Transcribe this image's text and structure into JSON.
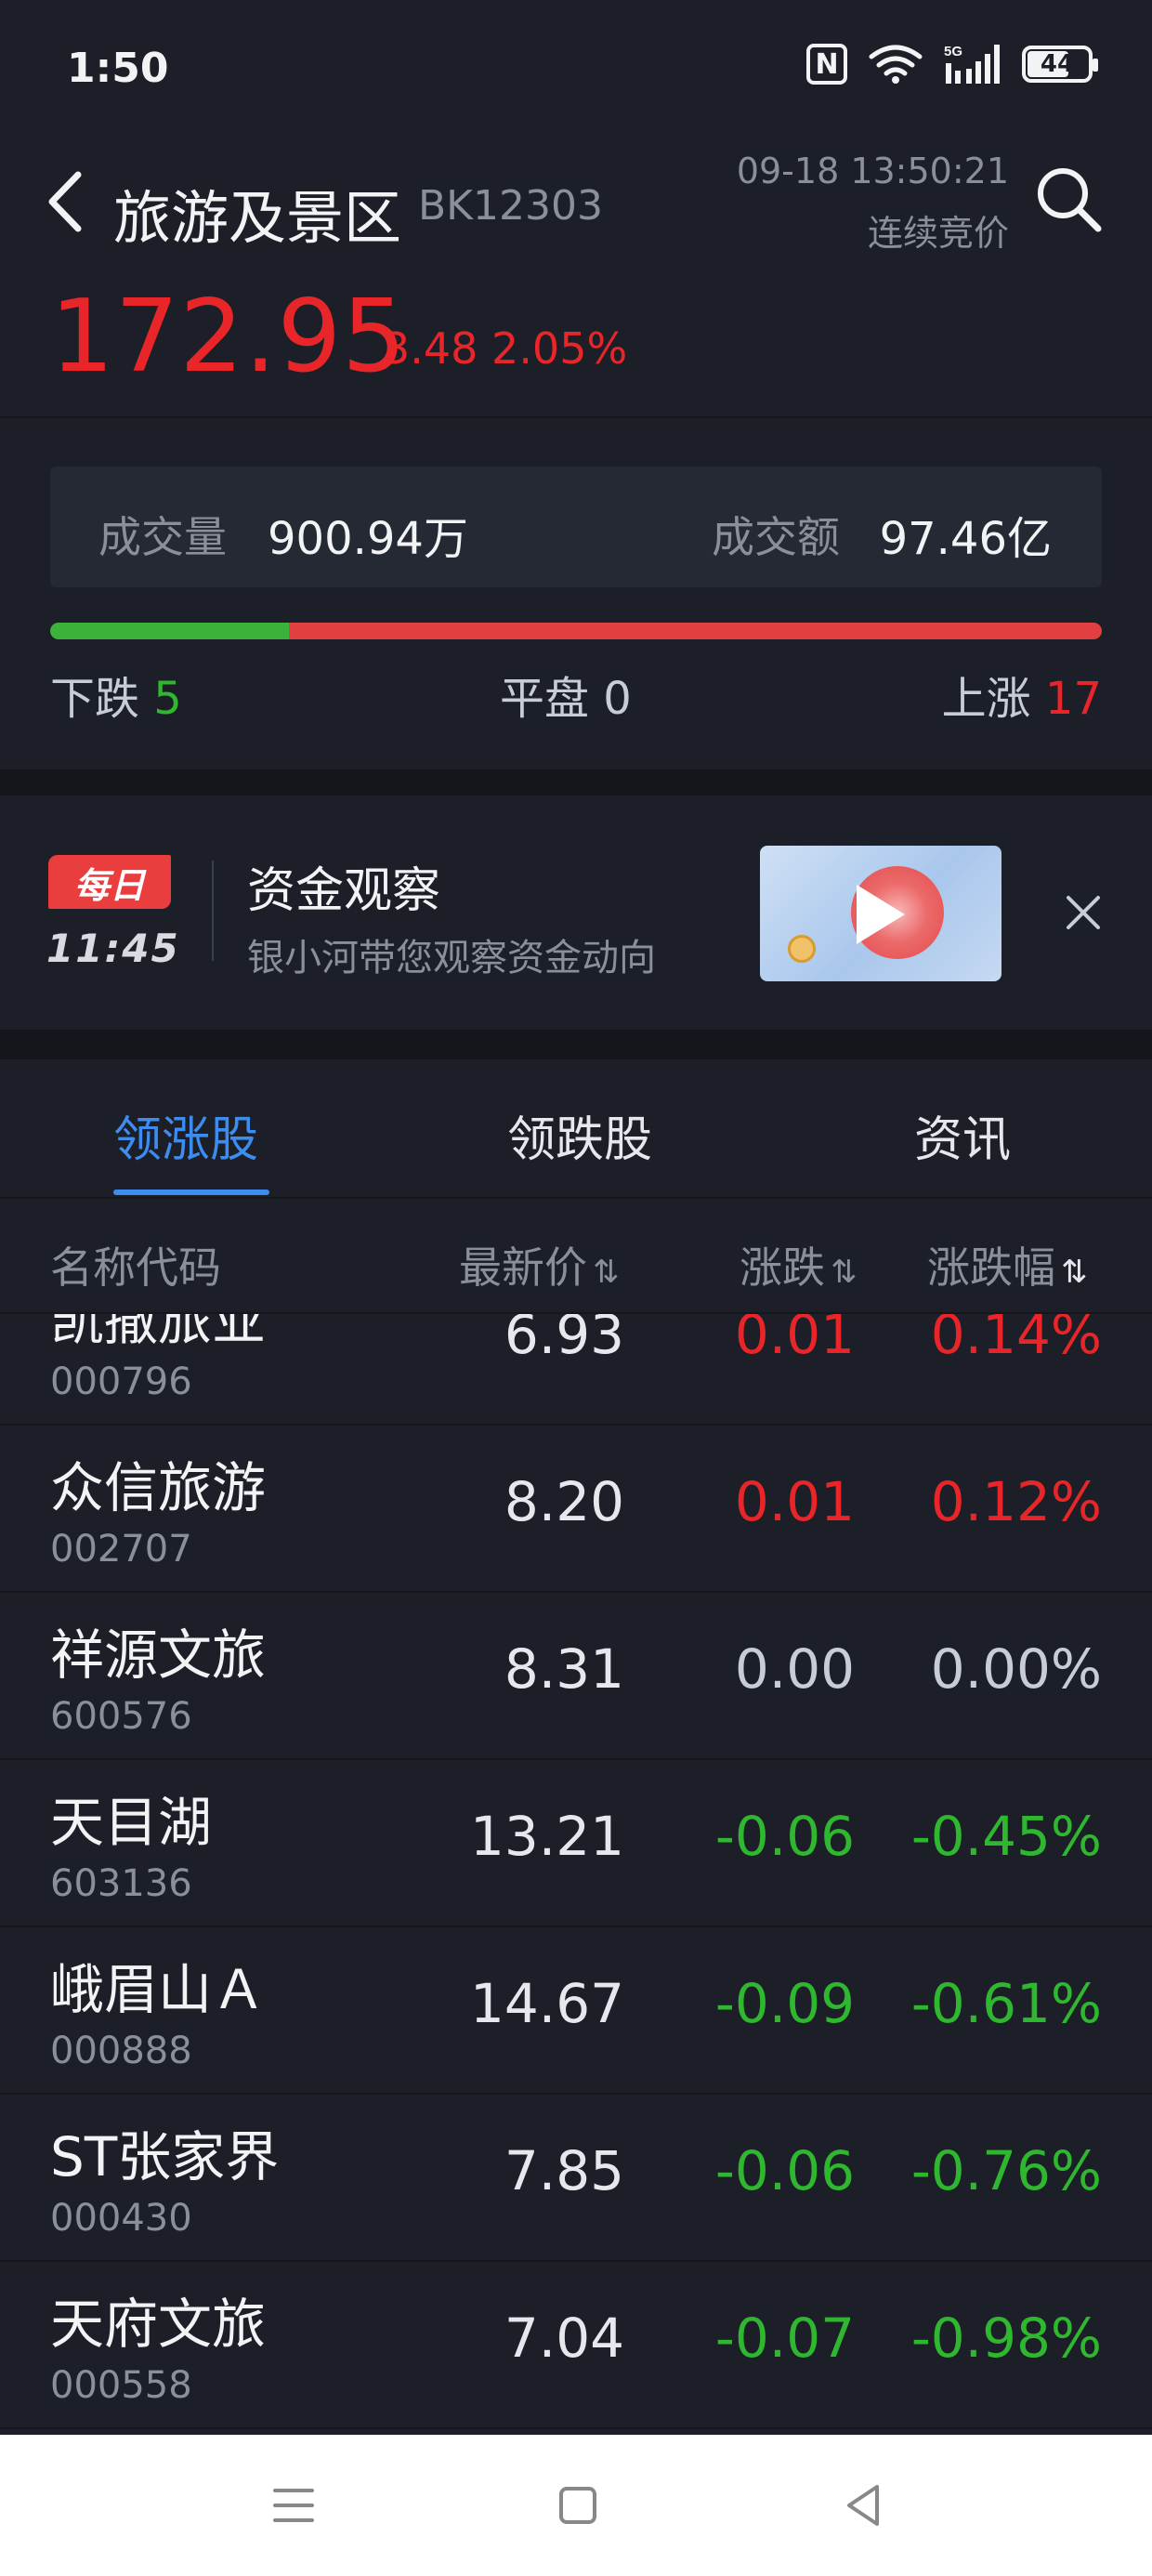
{
  "status_bar": {
    "time": "1:50",
    "network": "5G",
    "battery": "44"
  },
  "header": {
    "title": "旅游及景区",
    "code": "BK12303",
    "datetime": "09-18 13:50:21",
    "phase": "连续竞价",
    "price": "172.95",
    "change": "3.48",
    "change_pct": "2.05%"
  },
  "stats": {
    "volume_label": "成交量",
    "volume_value": "900.94万",
    "amount_label": "成交额",
    "amount_value": "97.46亿",
    "down_label": "下跌",
    "down_count": "5",
    "flat_label": "平盘",
    "flat_count": "0",
    "up_label": "上涨",
    "up_count": "17"
  },
  "breadth": {
    "down": 5,
    "flat": 0,
    "up": 17
  },
  "banner": {
    "badge": "每日",
    "time": "11:45",
    "title": "资金观察",
    "subtitle": "银小河带您观察资金动向"
  },
  "tabs": [
    {
      "label": "领涨股",
      "active": true
    },
    {
      "label": "领跌股",
      "active": false
    },
    {
      "label": "资讯",
      "active": false
    }
  ],
  "table": {
    "headers": {
      "name": "名称代码",
      "price": "最新价",
      "change": "涨跌",
      "change_pct": "涨跌幅"
    },
    "rows": [
      {
        "name": "凯撒旅业",
        "code": "000796",
        "price": "6.93",
        "change": "0.01",
        "change_pct": "0.14%",
        "dir": "pos"
      },
      {
        "name": "众信旅游",
        "code": "002707",
        "price": "8.20",
        "change": "0.01",
        "change_pct": "0.12%",
        "dir": "pos"
      },
      {
        "name": "祥源文旅",
        "code": "600576",
        "price": "8.31",
        "change": "0.00",
        "change_pct": "0.00%",
        "dir": "flat"
      },
      {
        "name": "天目湖",
        "code": "603136",
        "price": "13.21",
        "change": "-0.06",
        "change_pct": "-0.45%",
        "dir": "neg"
      },
      {
        "name": "峨眉山Ａ",
        "code": "000888",
        "price": "14.67",
        "change": "-0.09",
        "change_pct": "-0.61%",
        "dir": "neg"
      },
      {
        "name": "ST张家界",
        "code": "000430",
        "price": "7.85",
        "change": "-0.06",
        "change_pct": "-0.76%",
        "dir": "neg"
      },
      {
        "name": "天府文旅",
        "code": "000558",
        "price": "7.04",
        "change": "-0.07",
        "change_pct": "-0.98%",
        "dir": "neg"
      }
    ]
  },
  "colors": {
    "up": "#e8262a",
    "down": "#2fb82f",
    "accent": "#3d8cf0",
    "background": "#1c1f27"
  }
}
